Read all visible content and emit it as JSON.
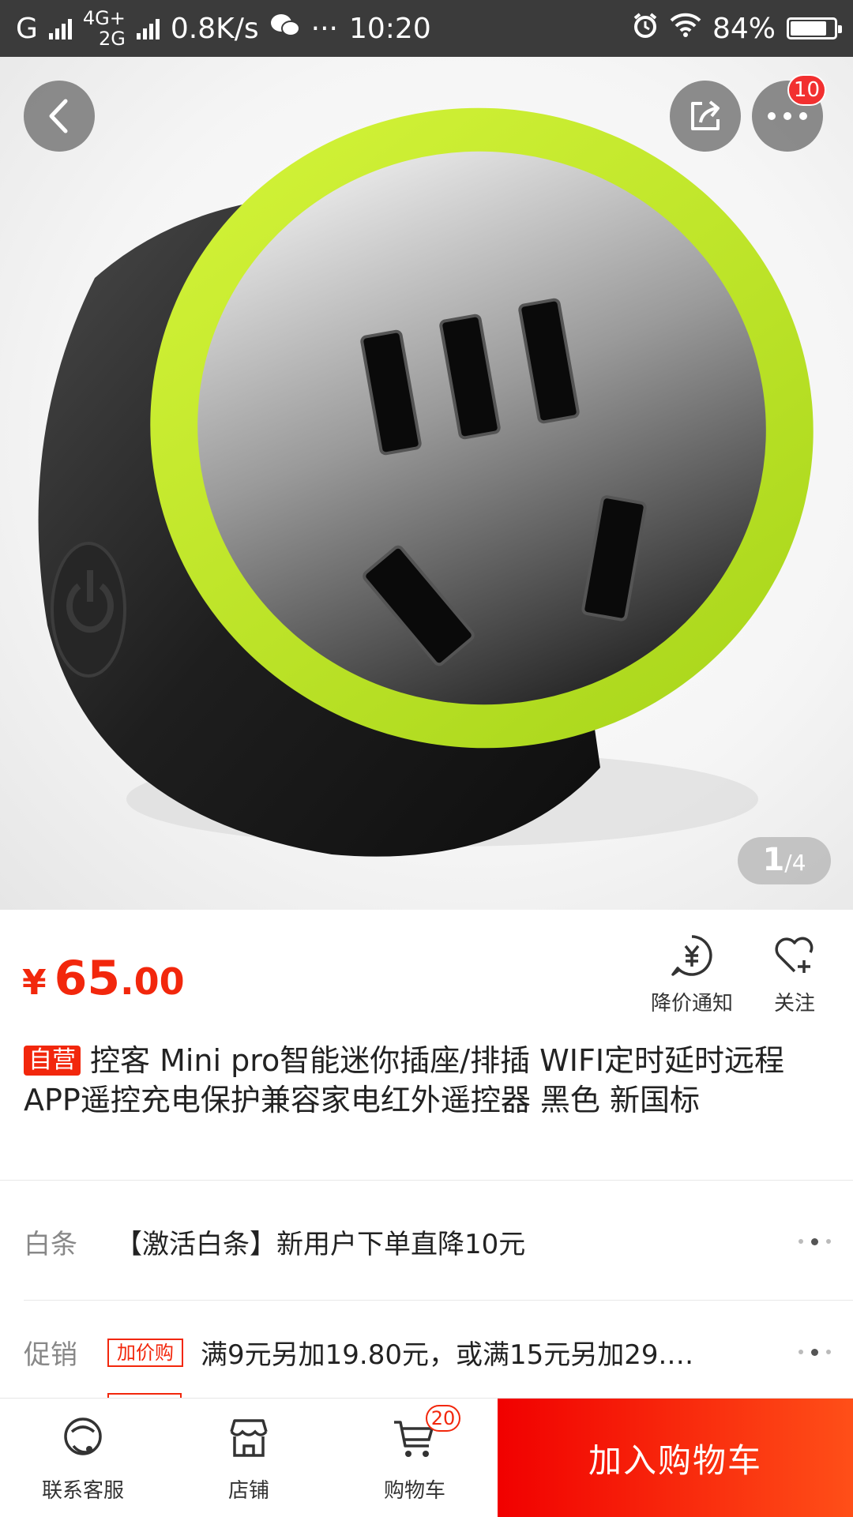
{
  "status_bar": {
    "carrier_1": "G",
    "net_top": "4G+",
    "net_bottom": "2G",
    "speed": "0.8K/s",
    "more": "···",
    "time": "10:20",
    "battery_text": "84%",
    "battery_level": 0.84
  },
  "hero": {
    "menu_badge": "10",
    "pager_current": "1",
    "pager_total": "/4",
    "icons": [
      "back-icon",
      "share-icon",
      "more-icon"
    ]
  },
  "price": {
    "currency": "¥",
    "integer": "65",
    "decimal": ".00"
  },
  "actions": {
    "price_alert": "降价通知",
    "follow": "关注"
  },
  "product": {
    "tag": "自营",
    "title": "控客 Mini pro智能迷你插座/排插 WIFI定时延时远程APP遥控充电保护兼容家电红外遥控器 黑色 新国标"
  },
  "baitiao": {
    "label": "白条",
    "content": "【激活白条】新用户下单直降10元"
  },
  "promotion": {
    "label": "促销",
    "tag": "加价购",
    "content": "满9元另加19.80元，或满15元另加29.…"
  },
  "bottom_bar": {
    "service": "联系客服",
    "shop": "店铺",
    "cart": "购物车",
    "cart_count": "20",
    "add_to_cart": "加入购物车"
  },
  "colors": {
    "accent": "#f2270c",
    "add_cart_start": "#f10000",
    "add_cart_end": "#ff4f18",
    "status_bar": "#3b3b3b",
    "product_ring": "#b5e51d"
  }
}
